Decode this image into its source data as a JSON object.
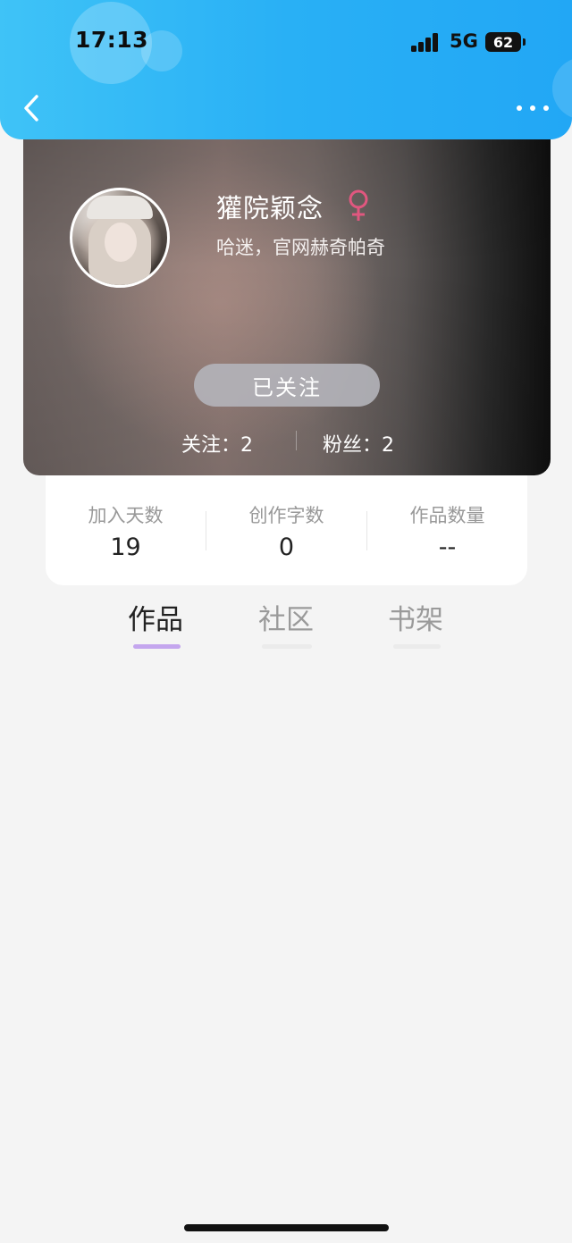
{
  "status_bar": {
    "time": "17:13",
    "network": "5G",
    "battery": "62",
    "signal_icon": "signal-bars-icon"
  },
  "header": {
    "back_icon": "chevron-left-icon",
    "more_icon": "more-dots-icon",
    "gradient_colors": [
      "#3fc3f7",
      "#22a7f5"
    ]
  },
  "profile": {
    "username": "獾院颖念",
    "gender_symbol": "♀",
    "gender_color": "#e0577f",
    "bio": "哈迷，官网赫奇帕奇",
    "follow_button_label": "已关注",
    "following_text": "关注：2",
    "fans_text": "粉丝：2"
  },
  "stats": [
    {
      "label": "加入天数",
      "value": "19"
    },
    {
      "label": "创作字数",
      "value": "0"
    },
    {
      "label": "作品数量",
      "value": "--"
    }
  ],
  "tabs": [
    {
      "label": "作品",
      "active": true
    },
    {
      "label": "社区",
      "active": false
    },
    {
      "label": "书架",
      "active": false
    }
  ],
  "colors": {
    "active_tab_underline": "#c4a6ee",
    "inactive_tab_text": "#9a9a9a",
    "page_background": "#f4f4f4"
  }
}
